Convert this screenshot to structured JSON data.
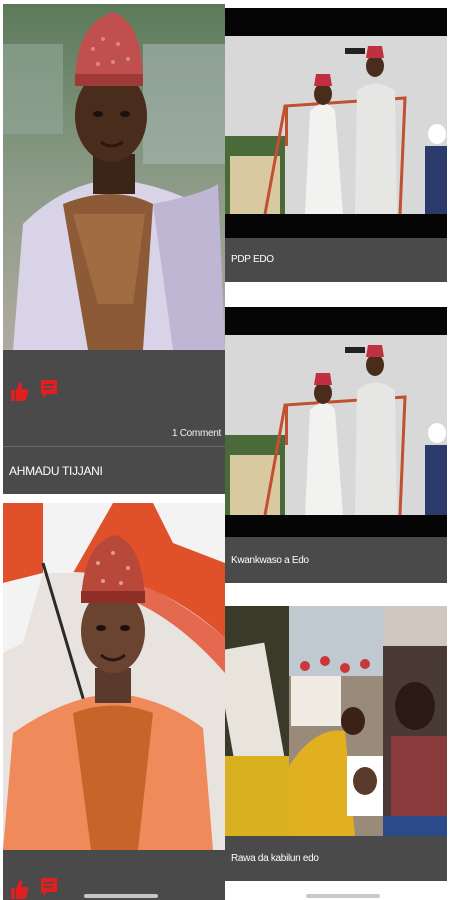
{
  "feed": {
    "left": [
      {
        "caption": "AHMADU TIJJANI",
        "comments": "1 Comment",
        "photo": "portrait-man-red-cap-white-robe"
      },
      {
        "caption": "",
        "photo": "portrait-man-red-umbrella-orange-robe"
      }
    ],
    "right": [
      {
        "caption": "PDP EDO",
        "photo": "rally-platform-crowd"
      },
      {
        "caption": "Kwankwaso a Edo",
        "photo": "rally-platform-crowd"
      },
      {
        "caption": "Rawa da kabilun edo",
        "photo": "rally-collage"
      }
    ]
  },
  "icons": {
    "like": "thumbs-up-icon",
    "comment": "comment-icon"
  },
  "colors": {
    "card_bg": "#4a4a4a",
    "accent": "#e02020",
    "text": "#ffffff"
  }
}
